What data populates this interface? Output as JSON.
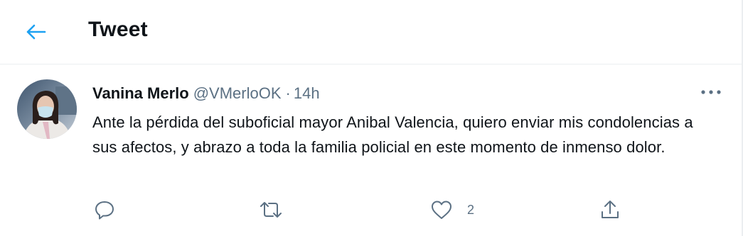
{
  "header": {
    "back_icon": "arrow-left-icon",
    "title": "Tweet",
    "accent_color": "#1da1f2"
  },
  "tweet": {
    "author_name": "Vanina Merlo",
    "author_handle": "@VMerloOK",
    "separator": "·",
    "timestamp": "14h",
    "text": "Ante la pérdida del suboficial mayor Anibal Valencia, quiero enviar mis condolencias a sus afectos, y abrazo a toda la familia policial en este momento de inmenso dolor.",
    "more_icon": "more-horizontal-icon",
    "actions": {
      "reply_icon": "reply-icon",
      "retweet_icon": "retweet-icon",
      "like_icon": "heart-icon",
      "like_count": "2",
      "share_icon": "share-icon"
    }
  },
  "colors": {
    "text": "#0f1419",
    "secondary": "#5b7083",
    "border": "#ebeef0"
  }
}
